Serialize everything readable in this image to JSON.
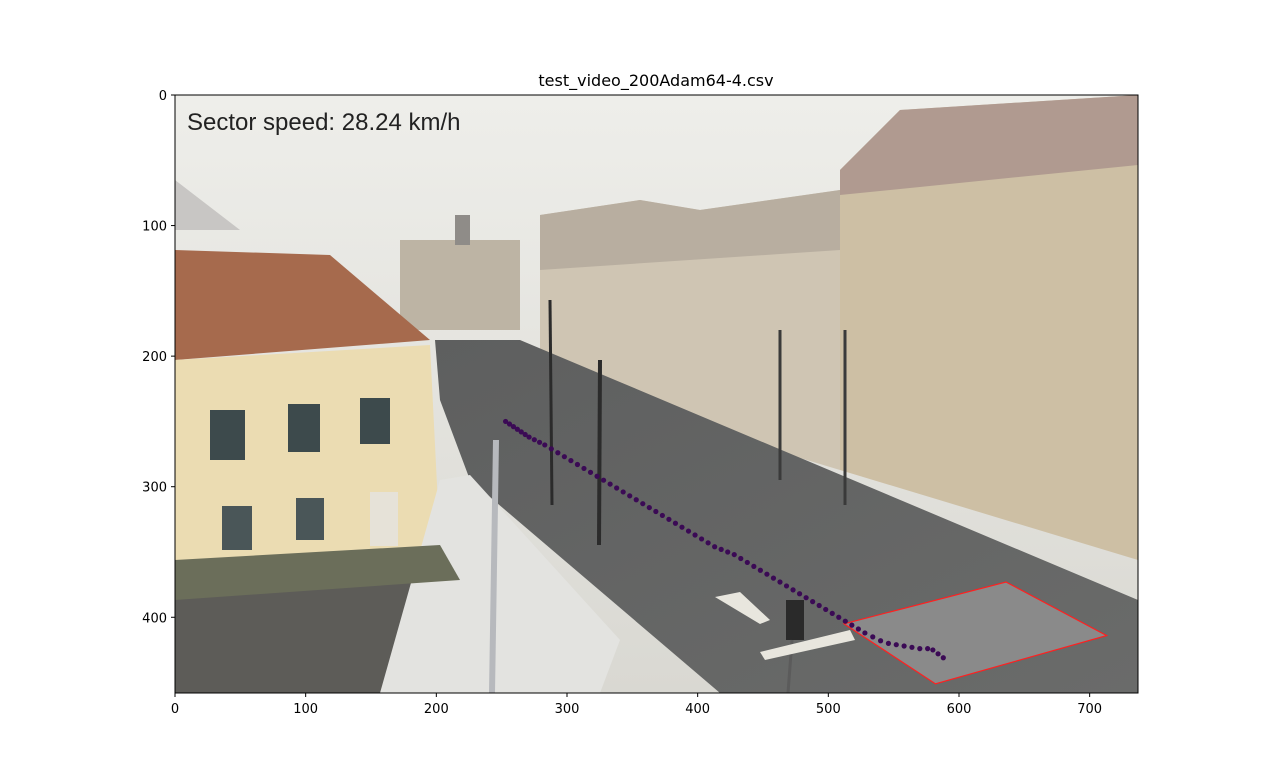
{
  "chart_data": {
    "type": "scatter",
    "title": "test_video_200Adam64-4.csv",
    "annotation": "Sector speed: 28.24 km/h",
    "xlim": [
      0,
      737
    ],
    "ylim": [
      458,
      0
    ],
    "y_inverted": true,
    "x_ticks": [
      0,
      100,
      200,
      300,
      400,
      500,
      600,
      700
    ],
    "y_ticks": [
      0,
      100,
      200,
      300,
      400
    ],
    "background": "photograph of a city street with buildings, trees, pedestrians and a road viewed from above",
    "point_color": "#3b0a55",
    "sector_fill": "#8a8a8a",
    "sector_edge": "#ff2020",
    "sector_polygon": [
      [
        512,
        405
      ],
      [
        636,
        373
      ],
      [
        713,
        414
      ],
      [
        582,
        451
      ]
    ],
    "series": [
      {
        "x": [
          253,
          256,
          259,
          262,
          265,
          268,
          271,
          275,
          279,
          283,
          288,
          293,
          298,
          303,
          308,
          313,
          318,
          323,
          328,
          333,
          338,
          343,
          348,
          353,
          358,
          363,
          368,
          373,
          378,
          383,
          388,
          393,
          398,
          403,
          408,
          413,
          418,
          423,
          428,
          433,
          438,
          443,
          448,
          453,
          458,
          463,
          468,
          473,
          478,
          483,
          488,
          493,
          498,
          503,
          508,
          513,
          518,
          523,
          528,
          534,
          540,
          546,
          552,
          558,
          564,
          570,
          576,
          580,
          584,
          588
        ],
        "y": [
          250,
          252,
          254,
          256,
          258,
          260,
          262,
          264,
          266,
          268,
          271,
          274,
          277,
          280,
          283,
          286,
          289,
          292,
          295,
          298,
          301,
          304,
          307,
          310,
          313,
          316,
          319,
          322,
          325,
          328,
          331,
          334,
          337,
          340,
          343,
          346,
          348,
          350,
          352,
          355,
          358,
          361,
          364,
          367,
          370,
          373,
          376,
          379,
          382,
          385,
          388,
          391,
          394,
          397,
          400,
          403,
          406,
          409,
          412,
          415,
          418,
          420,
          421,
          422,
          423,
          424,
          424,
          425,
          428,
          431
        ]
      }
    ]
  }
}
